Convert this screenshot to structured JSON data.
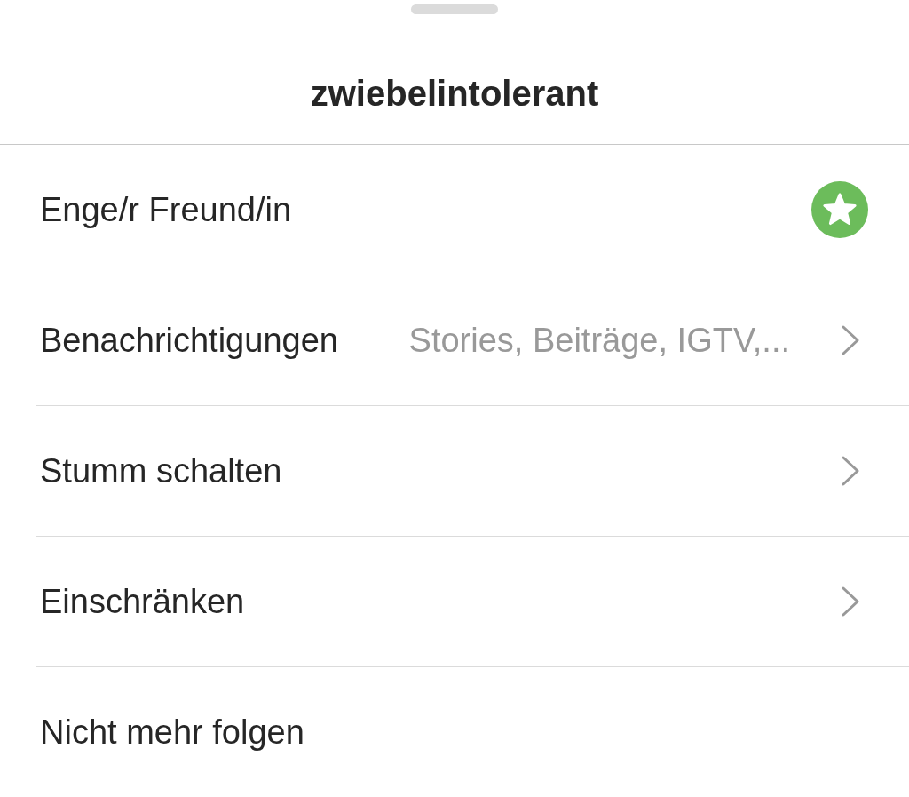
{
  "sheet": {
    "title": "zwiebelintolerant"
  },
  "items": [
    {
      "kind": "star",
      "label": "Enge/r Freund/in",
      "on": true
    },
    {
      "kind": "link",
      "label": "Benachrichtigungen",
      "value": "Stories, Beiträge, IGTV,..."
    },
    {
      "kind": "link",
      "label": "Stumm schalten"
    },
    {
      "kind": "link",
      "label": "Einschränken"
    },
    {
      "kind": "action",
      "label": "Nicht mehr folgen"
    }
  ]
}
